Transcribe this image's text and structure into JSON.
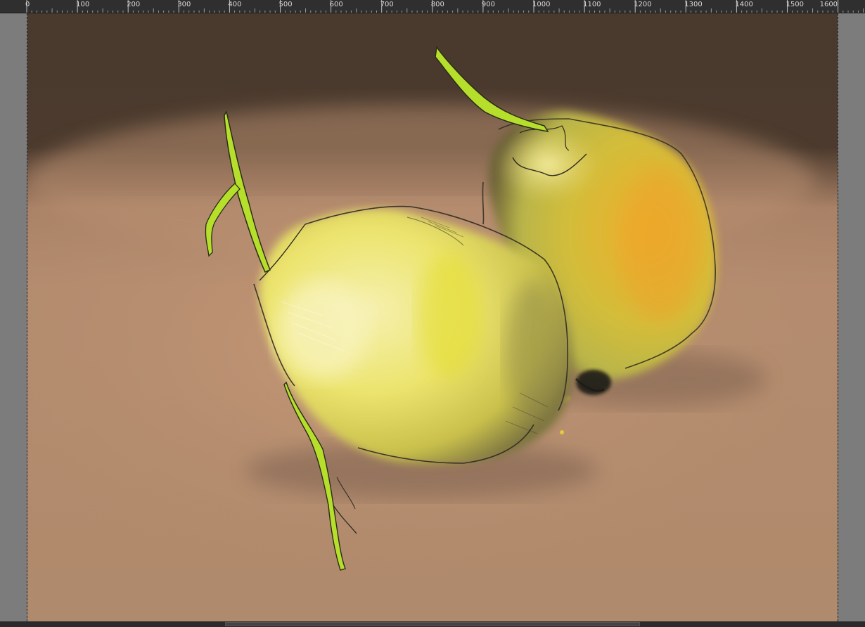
{
  "ruler": {
    "unit_labels": [
      "0",
      "100",
      "200",
      "300",
      "400",
      "500",
      "600",
      "700",
      "800",
      "900",
      "1000",
      "1100",
      "1200",
      "1300",
      "1400",
      "1500",
      "1600"
    ]
  },
  "canvas": {
    "subject": "two-pears-painting",
    "colors": {
      "background_top": "#4a3a2e",
      "table": "#b08a6c",
      "pear_yellow": "#ece28a",
      "pear_orange": "#e7a52a",
      "stem_green": "#b7e12c",
      "outline": "#2e2a22"
    }
  }
}
